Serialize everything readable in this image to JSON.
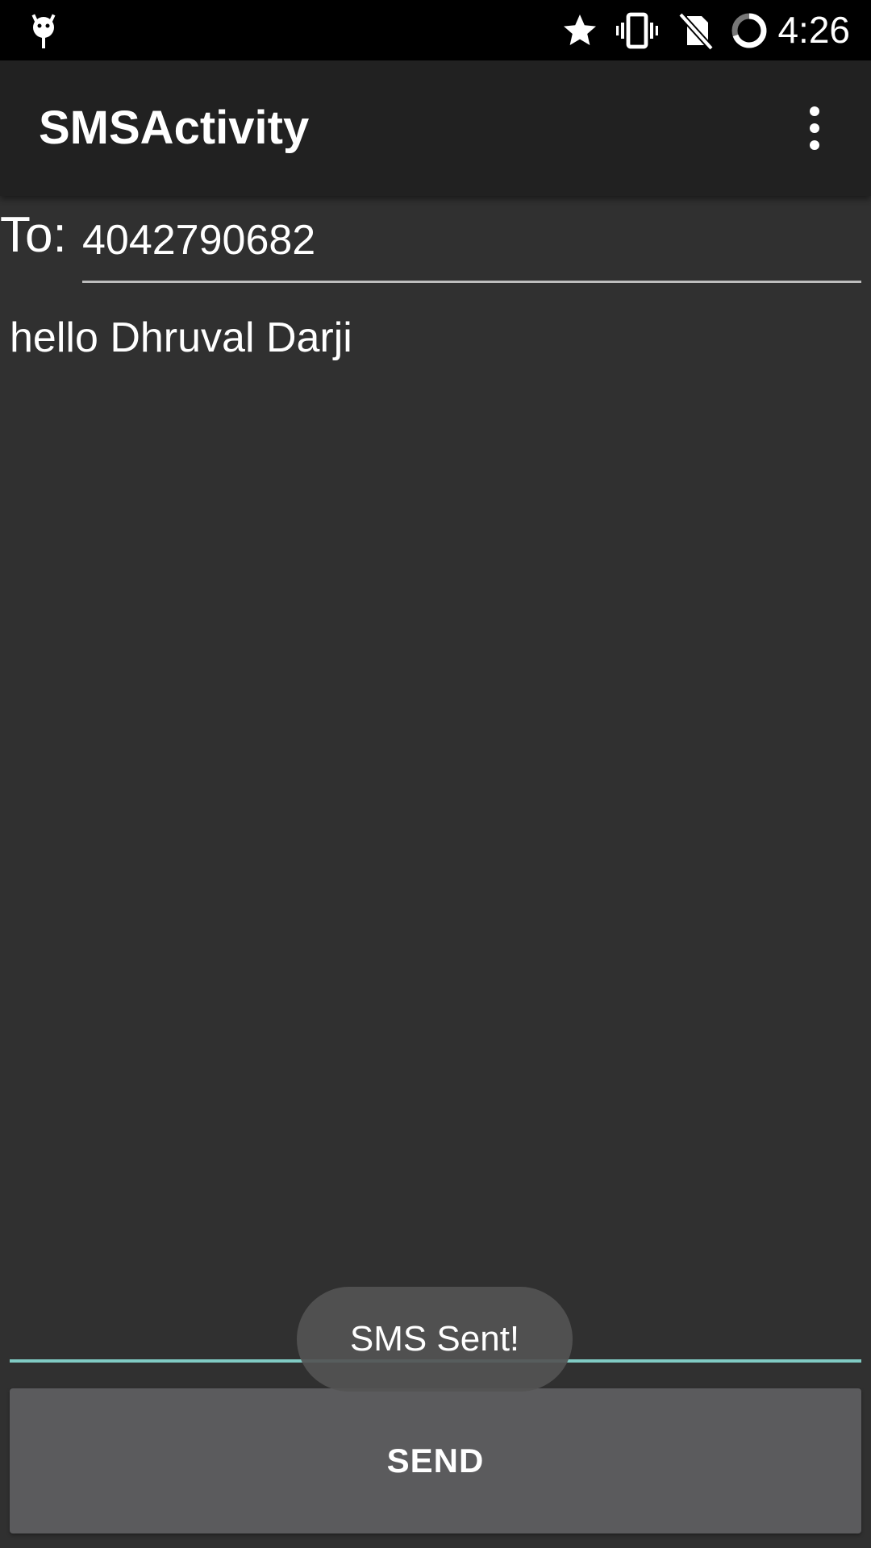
{
  "status_bar": {
    "time": "4:26",
    "icons": [
      "android-debug-icon",
      "star-icon",
      "vibrate-icon",
      "no-sim-icon",
      "sync-circle-icon"
    ]
  },
  "app_bar": {
    "title": "SMSActivity",
    "menu_icon": "overflow-menu-icon"
  },
  "form": {
    "to_label": "To:",
    "to_value": "4042790682",
    "message_value": "hello Dhruval Darji",
    "send_label": "SEND"
  },
  "toast": {
    "text": "SMS Sent!"
  },
  "colors": {
    "status_bar": "#000000",
    "app_bar": "#212121",
    "background": "#303030",
    "accent_underline": "#80cbc4",
    "button": "#5b5b5d"
  }
}
